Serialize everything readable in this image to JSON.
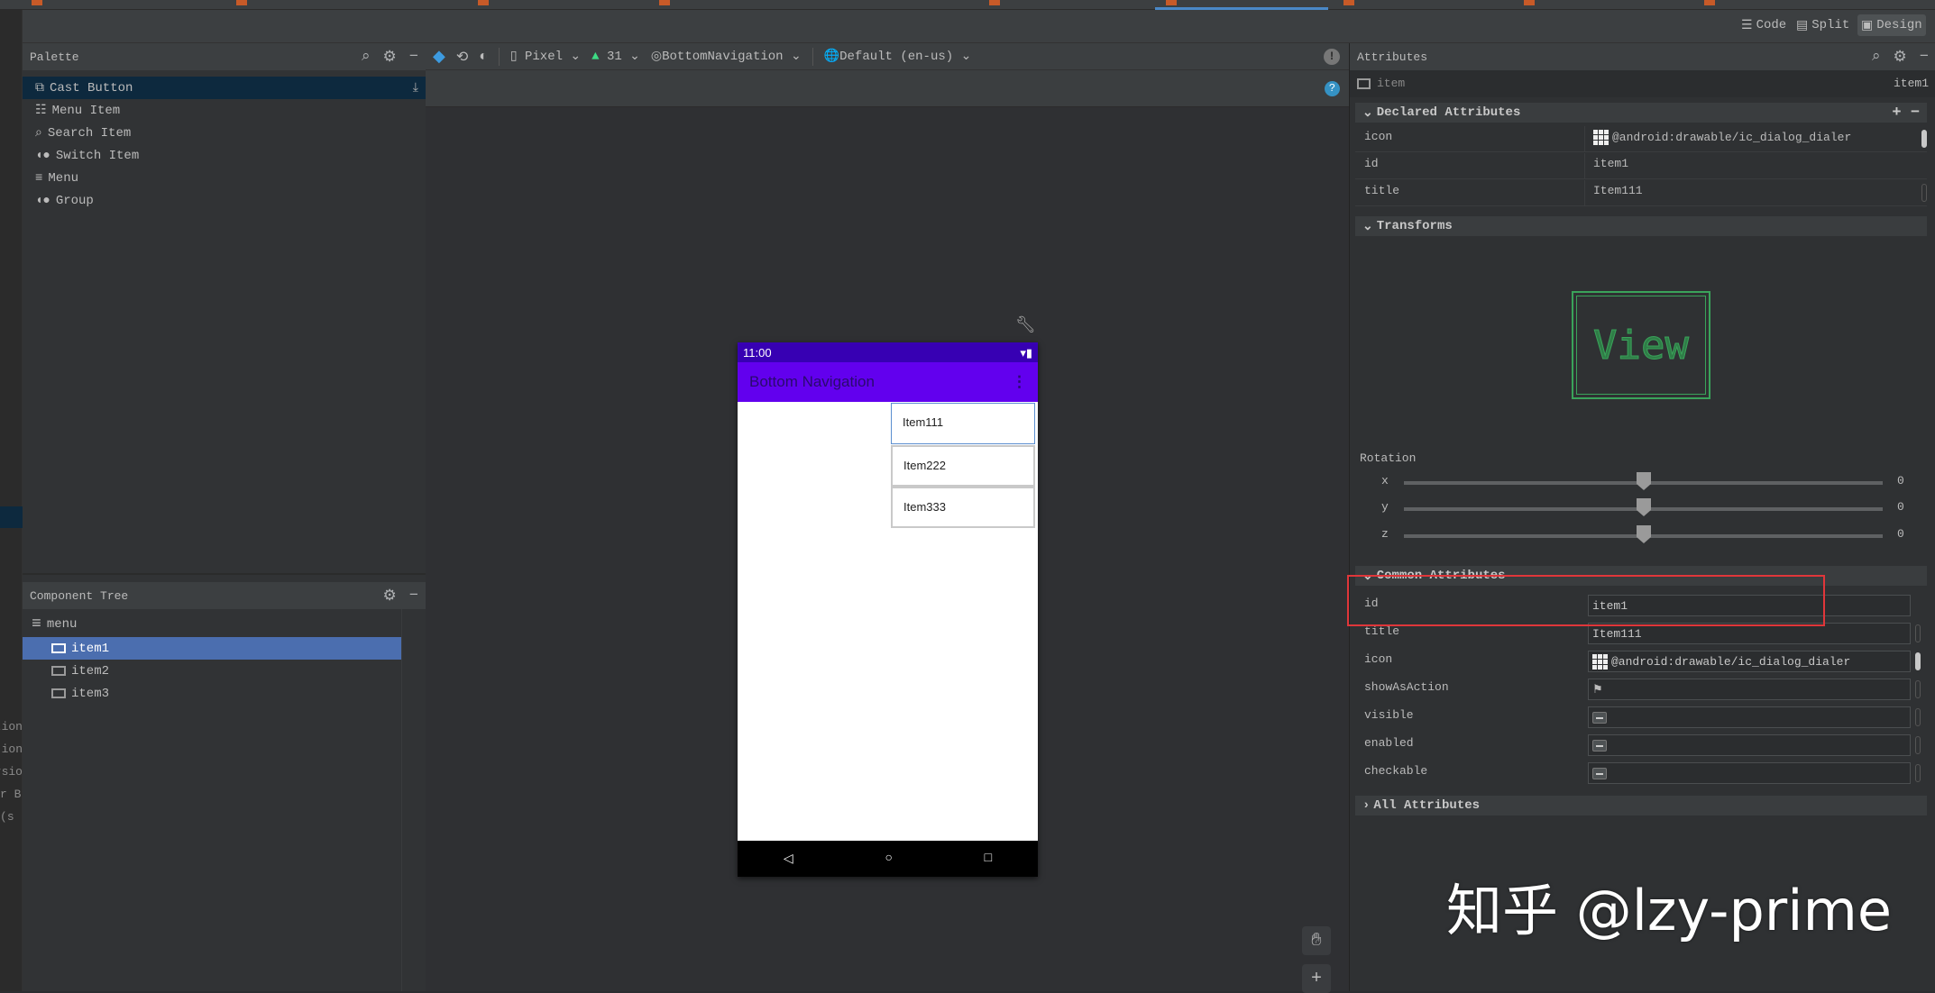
{
  "editor_modes": {
    "code": "Code",
    "split": "Split",
    "design": "Design",
    "active": "Design"
  },
  "gutter_code_fragments": [
    "tion",
    "ion.",
    "rsio",
    "r B",
    "s)"
  ],
  "palette": {
    "title": "Palette",
    "items": [
      {
        "label": "Cast Button",
        "icon": "cast-icon",
        "selected": true
      },
      {
        "label": "Menu Item",
        "icon": "list-icon"
      },
      {
        "label": "Search Item",
        "icon": "search-icon"
      },
      {
        "label": "Switch Item",
        "icon": "switch-icon"
      },
      {
        "label": "Menu",
        "icon": "menu-icon"
      },
      {
        "label": "Group",
        "icon": "group-icon"
      }
    ]
  },
  "component_tree": {
    "title": "Component Tree",
    "root": "menu",
    "items": [
      {
        "label": "item1",
        "selected": true
      },
      {
        "label": "item2"
      },
      {
        "label": "item3"
      }
    ]
  },
  "design_toolbar": {
    "device": "Pixel",
    "api": "31",
    "theme": "BottomNavigation",
    "locale": "Default (en-us)"
  },
  "preview": {
    "time": "11:00",
    "app_title": "Bottom Navigation",
    "menu_items": [
      "Item111",
      "Item222",
      "Item333"
    ],
    "colors": {
      "status_bar": "#3700b3",
      "app_bar": "#6200ee"
    }
  },
  "attributes": {
    "title": "Attributes",
    "element_type": "item",
    "element_id": "item1",
    "declared_header": "Declared Attributes",
    "declared": [
      {
        "name": "icon",
        "value": "@android:drawable/ic_dialog_dialer"
      },
      {
        "name": "id",
        "value": "item1"
      },
      {
        "name": "title",
        "value": "Item111"
      }
    ],
    "transforms_header": "Transforms",
    "view_label": "View",
    "rotation_label": "Rotation",
    "rotation": [
      {
        "axis": "x",
        "value": "0"
      },
      {
        "axis": "y",
        "value": "0"
      },
      {
        "axis": "z",
        "value": "0"
      }
    ],
    "common_header": "Common Attributes",
    "common": [
      {
        "name": "id",
        "value": "item1"
      },
      {
        "name": "title",
        "value": "Item111"
      },
      {
        "name": "icon",
        "value": "@android:drawable/ic_dialog_dialer"
      },
      {
        "name": "showAsAction",
        "value": ""
      },
      {
        "name": "visible",
        "value": ""
      },
      {
        "name": "enabled",
        "value": ""
      },
      {
        "name": "checkable",
        "value": ""
      }
    ],
    "all_header": "All Attributes"
  },
  "watermark": "知乎 @lzy-prime",
  "highlight_color": "#e0363a"
}
